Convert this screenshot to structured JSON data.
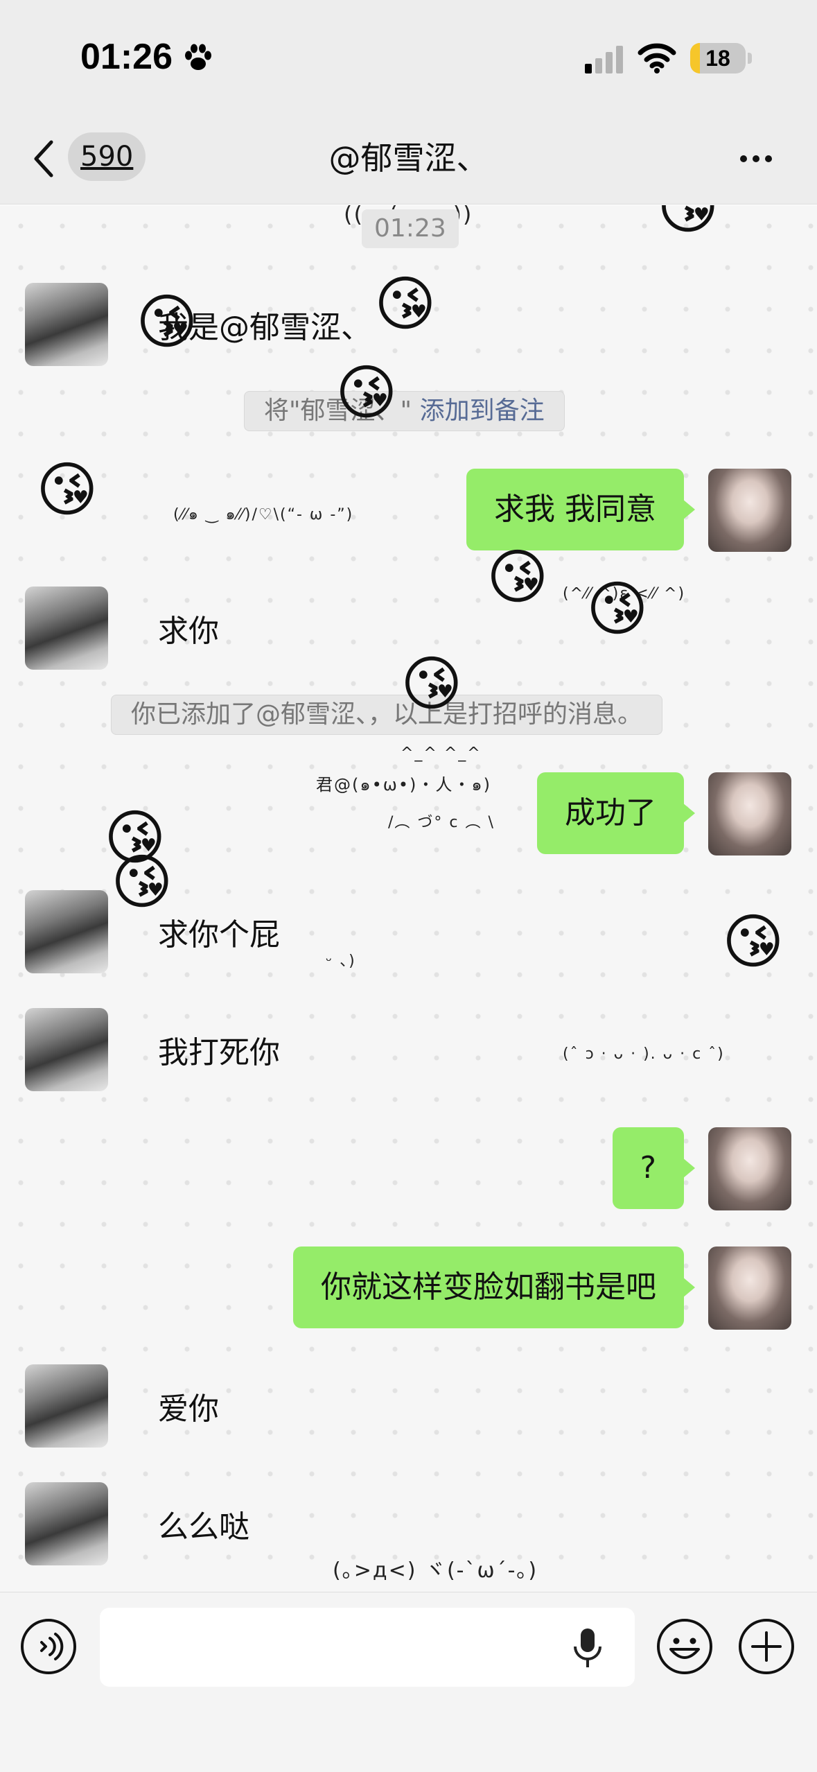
{
  "status_bar": {
    "time": "01:26",
    "battery": "18",
    "battery_level": 0.18
  },
  "nav": {
    "back_count": "590",
    "title": "@郁雪涩、"
  },
  "chat": {
    "timestamp": "01:23",
    "messages": [
      {
        "side": "left",
        "text": "我是@郁雪涩、"
      },
      {
        "side": "system",
        "text": "将\"郁雪涩、\"",
        "link": "添加到备注"
      },
      {
        "side": "right",
        "text": "求我 我同意"
      },
      {
        "side": "left",
        "text": "求你"
      },
      {
        "side": "system",
        "text": "你已添加了@郁雪涩、，以上是打招呼的消息。"
      },
      {
        "side": "right",
        "text": "成功了"
      },
      {
        "side": "left",
        "text": "求你个屁"
      },
      {
        "side": "left",
        "text": "我打死你"
      },
      {
        "side": "right",
        "text": "?"
      },
      {
        "side": "right",
        "text": "你就这样变脸如翻书是吧"
      },
      {
        "side": "left",
        "text": "爱你"
      },
      {
        "side": "left",
        "text": "么么哒"
      }
    ],
    "kaomoji": [
      "((   ·  (-ω-o))",
      "(⁄⁄๑ ‿ ๑⁄⁄)/♡\\(“- ω -”)",
      "(^⁄⁄ ^)ε <⁄⁄ ^)",
      "^_^   ^_^",
      "君@(๑•ω•)・人・๑)",
      "/︵  づ° c ︵ \\",
      "ᵕ  、)",
      "(ˆ ɔ · ᴗ · ). ᴗ · c ˆ)",
      "(｡>д<) ヾ(-`ω´-｡)"
    ],
    "floating_emoji": "😘"
  },
  "input_bar": {
    "placeholder": ""
  }
}
